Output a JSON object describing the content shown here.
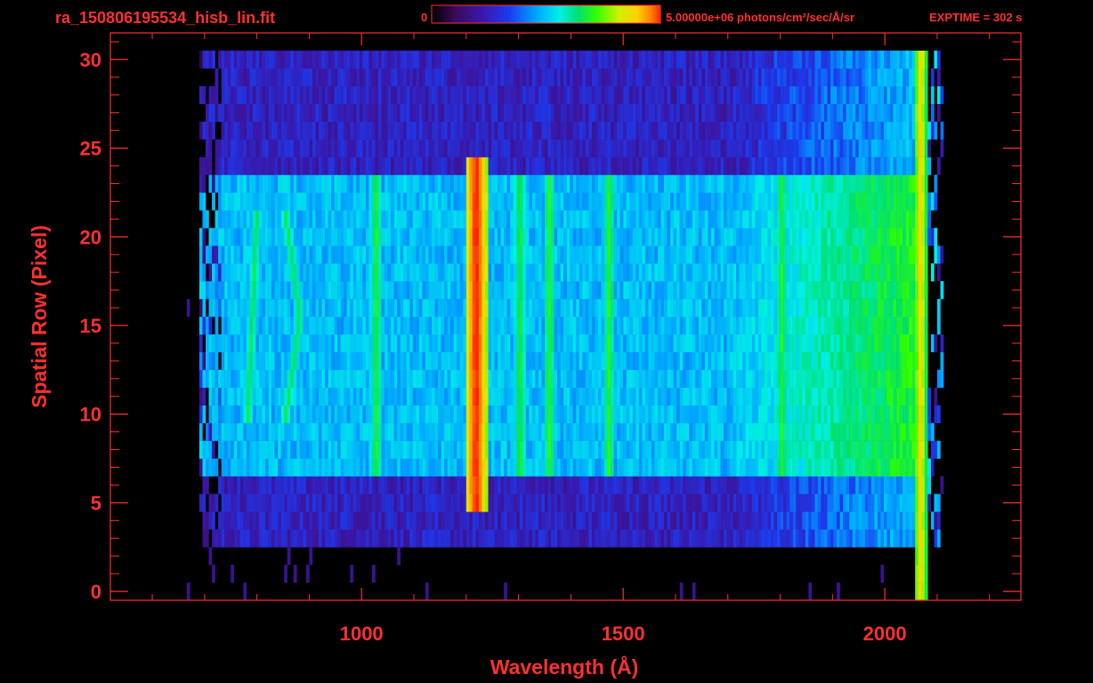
{
  "header": {
    "filename": "ra_150806195534_hisb_lin.fit",
    "colorbar_min": "0",
    "colorbar_max_label": "5.00000e+06 photons/cm²/sec/Å/sr",
    "exptime": "EXPTIME = 302 s"
  },
  "colors": {
    "axis": "#ff3030",
    "background": "#000000",
    "colormap": [
      "#000000",
      "#3a0a5a",
      "#3a17a8",
      "#1a3cf0",
      "#00a8ff",
      "#00f0e8",
      "#00e070",
      "#30ff00",
      "#d0f000",
      "#ffd000",
      "#ff8000",
      "#ff2000"
    ]
  },
  "chart_data": {
    "type": "heatmap",
    "title": "ra_150806195534_hisb_lin.fit",
    "xlabel": "Wavelength (Å)",
    "ylabel": "Spatial Row (Pixel)",
    "xlim": [
      520,
      2260
    ],
    "ylim": [
      -0.5,
      31.5
    ],
    "xticks": [
      1000,
      1500,
      2000
    ],
    "yticks": [
      0,
      5,
      10,
      15,
      20,
      25,
      30
    ],
    "colorbar": {
      "min": 0,
      "max": 5000000,
      "units": "photons/cm²/sec/Å/sr"
    },
    "exptime_s": 302,
    "grid": false,
    "signal_extent": {
      "wavelength_range": [
        690,
        2070
      ],
      "rows_covered": [
        3,
        30
      ],
      "bright_slit_rows": [
        7,
        23
      ]
    },
    "features": [
      {
        "wavelength": 1216,
        "rows": [
          5,
          24
        ],
        "level": "highest"
      },
      {
        "wavelength": 820,
        "rows": [
          10,
          21
        ],
        "level": "medium",
        "shape": "arc"
      },
      {
        "wavelength": 1025,
        "rows": [
          7,
          23
        ],
        "level": "medium"
      },
      {
        "wavelength": 1300,
        "rows": [
          7,
          23
        ],
        "level": "medium"
      },
      {
        "wavelength": 1356,
        "rows": [
          7,
          23
        ],
        "level": "medium"
      },
      {
        "wavelength": 1470,
        "rows": [
          7,
          23
        ],
        "level": "medium"
      },
      {
        "wavelength": 1800,
        "rows": [
          7,
          23
        ],
        "level": "medium"
      },
      {
        "wavelength": 2065,
        "rows": [
          0,
          30
        ],
        "level": "high"
      }
    ]
  }
}
